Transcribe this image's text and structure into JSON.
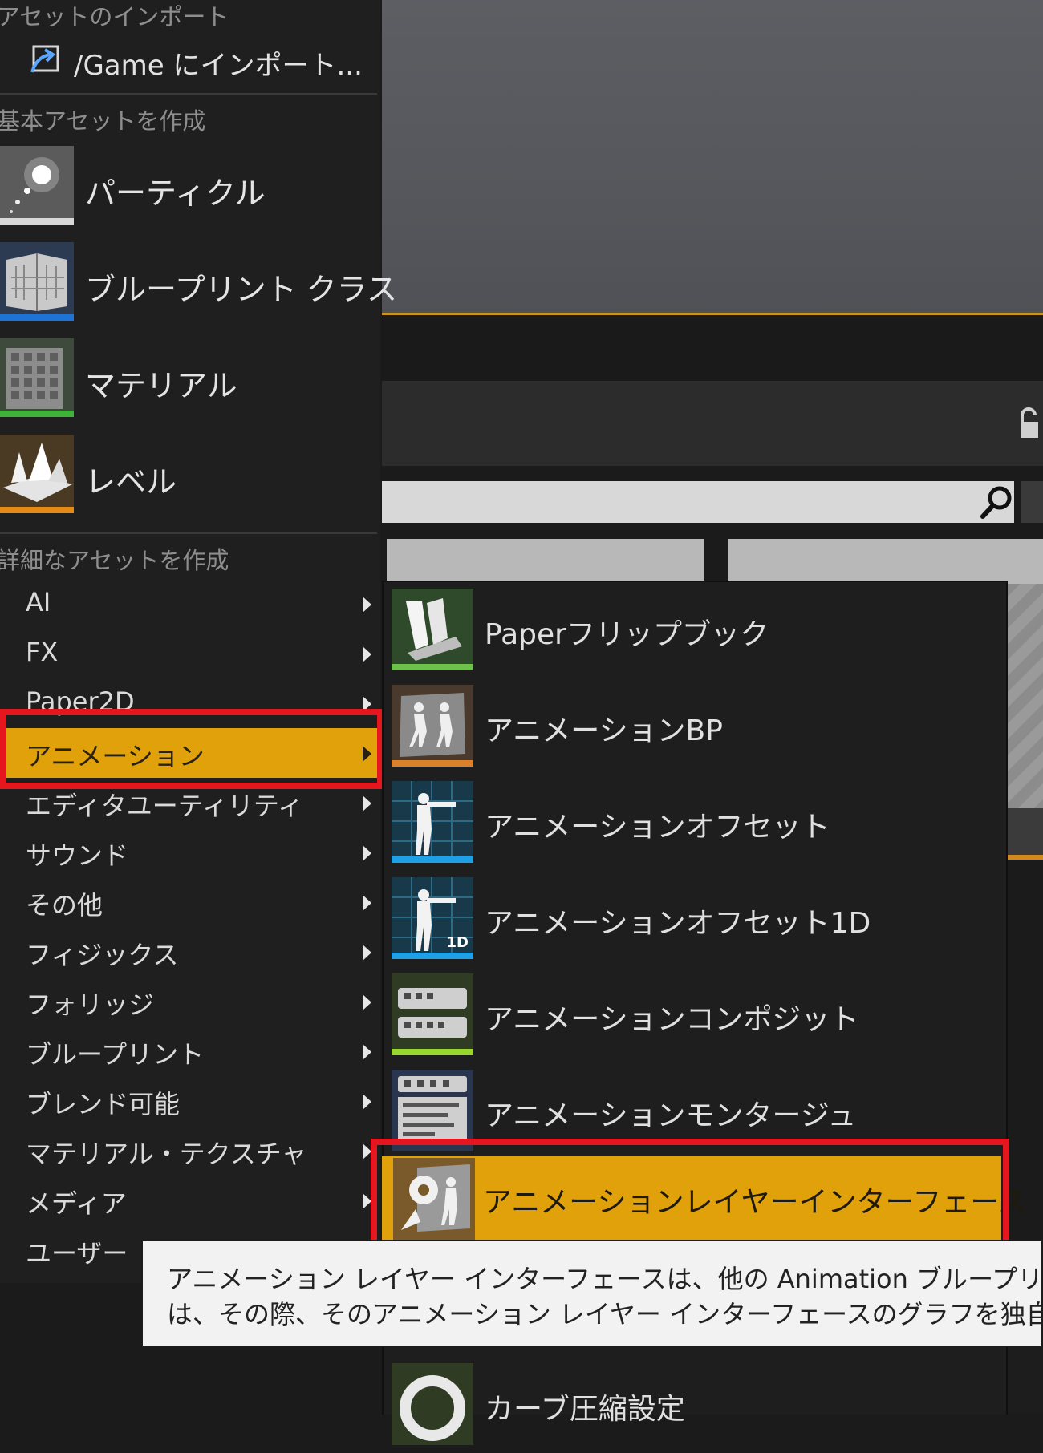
{
  "import_section": {
    "header": "アセットのインポート",
    "import_label": "/Game にインポート..."
  },
  "basic_section": {
    "header": "基本アセットを作成",
    "items": [
      {
        "label": "パーティクル",
        "icon": "particle-icon",
        "bar_color": "#d8d8d8"
      },
      {
        "label": "ブループリント クラス",
        "icon": "blueprint-class-icon",
        "bar_color": "#1e73d6"
      },
      {
        "label": "マテリアル",
        "icon": "material-icon",
        "bar_color": "#3fb23a"
      },
      {
        "label": "レベル",
        "icon": "level-icon",
        "bar_color": "#e58a14"
      }
    ]
  },
  "advanced_section": {
    "header": "詳細なアセットを作成",
    "categories": [
      {
        "label": "AI"
      },
      {
        "label": "FX"
      },
      {
        "label": "Paper2D"
      },
      {
        "label": "アニメーション",
        "active": true
      },
      {
        "label": "エディタユーティリティ"
      },
      {
        "label": "サウンド"
      },
      {
        "label": "その他"
      },
      {
        "label": "フィジックス"
      },
      {
        "label": "フォリッジ"
      },
      {
        "label": "ブループリント"
      },
      {
        "label": "ブレンド可能"
      },
      {
        "label": "マテリアル・テクスチャ"
      },
      {
        "label": "メディア"
      },
      {
        "label": "ユーザー"
      }
    ]
  },
  "submenu": {
    "items": [
      {
        "label": "Paperフリップブック",
        "icon": "paper-flipbook-icon",
        "bar_color": "#6cc24a"
      },
      {
        "label": "アニメーションBP",
        "icon": "animation-bp-icon",
        "bar_color": "#d9822b"
      },
      {
        "label": "アニメーションオフセット",
        "icon": "aim-offset-icon",
        "bar_color": "#1ea0e6"
      },
      {
        "label": "アニメーションオフセット1D",
        "icon": "aim-offset-1d-icon",
        "bar_color": "#1ea0e6",
        "badge": "1D"
      },
      {
        "label": "アニメーションコンポジット",
        "icon": "anim-composite-icon",
        "bar_color": "#9ad72e"
      },
      {
        "label": "アニメーションモンタージュ",
        "icon": "anim-montage-icon",
        "bar_color": "#4a6fb5"
      },
      {
        "label": "アニメーションレイヤーインターフェース",
        "icon": "anim-layer-interface-icon",
        "bar_color": "#d9822b",
        "active": true
      },
      {
        "label": "カーブ圧縮設定",
        "icon": "curve-compression-icon",
        "bar_color": "#6cc24a"
      }
    ]
  },
  "tooltip": {
    "line1": "アニメーション レイヤー インターフェースは、他の Animation ブループリン",
    "line2": "は、その際、そのアニメーション レイヤー インターフェースのグラフを独自の"
  },
  "colors": {
    "accent": "#e0a10b",
    "highlight": "#e5161d",
    "viewport_edge": "#c9931c"
  }
}
